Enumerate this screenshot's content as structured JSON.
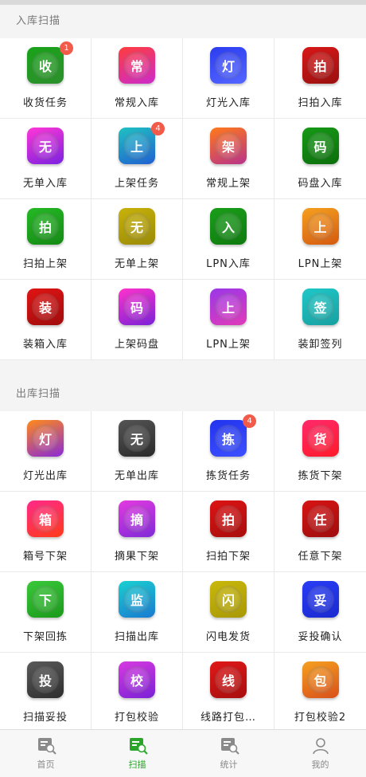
{
  "sections": [
    {
      "title": "入库扫描",
      "items": [
        {
          "glyph": "收",
          "label": "收货任务",
          "badge": "1",
          "colors": [
            "#19a319",
            "#2d8f2d"
          ]
        },
        {
          "glyph": "常",
          "label": "常规入库",
          "badge": "",
          "colors": [
            "#ff3d3d",
            "#cc2bcc"
          ]
        },
        {
          "glyph": "灯",
          "label": "灯光入库",
          "badge": "",
          "colors": [
            "#2b3cf0",
            "#5566ff"
          ]
        },
        {
          "glyph": "拍",
          "label": "扫拍入库",
          "badge": "",
          "colors": [
            "#d81818",
            "#9a1010"
          ]
        },
        {
          "glyph": "无",
          "label": "无单入库",
          "badge": "",
          "colors": [
            "#ff36d6",
            "#7b22e0"
          ]
        },
        {
          "glyph": "上",
          "label": "上架任务",
          "badge": "4",
          "colors": [
            "#1fc2c2",
            "#2060d0"
          ]
        },
        {
          "glyph": "架",
          "label": "常规上架",
          "badge": "",
          "colors": [
            "#ff7a1a",
            "#b8328a"
          ]
        },
        {
          "glyph": "码",
          "label": "码盘入库",
          "badge": "",
          "colors": [
            "#169a16",
            "#0c6e0c"
          ]
        },
        {
          "glyph": "拍",
          "label": "扫拍上架",
          "badge": "",
          "colors": [
            "#25b825",
            "#158a15"
          ]
        },
        {
          "glyph": "无",
          "label": "无单上架",
          "badge": "",
          "colors": [
            "#c8b20a",
            "#9a8a08"
          ]
        },
        {
          "glyph": "入",
          "label": "LPN入库",
          "badge": "",
          "colors": [
            "#1a9e1a",
            "#0f7a0f"
          ]
        },
        {
          "glyph": "上",
          "label": "LPN上架",
          "badge": "",
          "colors": [
            "#f5a020",
            "#d45a10"
          ]
        },
        {
          "glyph": "装",
          "label": "装箱入库",
          "badge": "",
          "colors": [
            "#e01414",
            "#a00c0c"
          ]
        },
        {
          "glyph": "码",
          "label": "上架码盘",
          "badge": "",
          "colors": [
            "#ff33cc",
            "#7a22d6"
          ]
        },
        {
          "glyph": "上",
          "label": "LPN上架",
          "badge": "",
          "colors": [
            "#9a38e8",
            "#e03ab8"
          ]
        },
        {
          "glyph": "签",
          "label": "装卸签列",
          "badge": "",
          "colors": [
            "#1fc7c7",
            "#18a0a0"
          ]
        }
      ]
    },
    {
      "title": "出库扫描",
      "items": [
        {
          "glyph": "灯",
          "label": "灯光出库",
          "badge": "",
          "colors": [
            "#ff8a1a",
            "#8a2ad6"
          ]
        },
        {
          "glyph": "无",
          "label": "无单出库",
          "badge": "",
          "colors": [
            "#555555",
            "#2a2a2a"
          ]
        },
        {
          "glyph": "拣",
          "label": "拣货任务",
          "badge": "4",
          "colors": [
            "#2233ee",
            "#3d50ff"
          ]
        },
        {
          "glyph": "货",
          "label": "拣货下架",
          "badge": "",
          "colors": [
            "#ff2a6a",
            "#ff1a2a"
          ]
        },
        {
          "glyph": "箱",
          "label": "箱号下架",
          "badge": "",
          "colors": [
            "#ff2a8a",
            "#ff3a1a"
          ]
        },
        {
          "glyph": "摘",
          "label": "摘果下架",
          "badge": "",
          "colors": [
            "#e43adf",
            "#7f2ad8"
          ]
        },
        {
          "glyph": "拍",
          "label": "扫拍下架",
          "badge": "",
          "colors": [
            "#dd1414",
            "#a80d0d"
          ]
        },
        {
          "glyph": "任",
          "label": "任意下架",
          "badge": "",
          "colors": [
            "#d81414",
            "#9e0d0d"
          ]
        },
        {
          "glyph": "下",
          "label": "下架回拣",
          "badge": "",
          "colors": [
            "#3ac83a",
            "#1a9a1a"
          ]
        },
        {
          "glyph": "监",
          "label": "扫描出库",
          "badge": "",
          "colors": [
            "#1ad0d0",
            "#1a7ad0"
          ]
        },
        {
          "glyph": "闪",
          "label": "闪电发货",
          "badge": "",
          "colors": [
            "#c9b80a",
            "#a89808"
          ]
        },
        {
          "glyph": "妥",
          "label": "妥投确认",
          "badge": "",
          "colors": [
            "#2a3cf5",
            "#1a2ad0"
          ]
        },
        {
          "glyph": "投",
          "label": "扫描妥投",
          "badge": "",
          "colors": [
            "#5a5a5a",
            "#2e2e2e"
          ]
        },
        {
          "glyph": "校",
          "label": "打包校验",
          "badge": "",
          "colors": [
            "#d83ae0",
            "#7a22d6"
          ]
        },
        {
          "glyph": "线",
          "label": "线路打包…",
          "badge": "",
          "colors": [
            "#e01818",
            "#a80e0e"
          ]
        },
        {
          "glyph": "包",
          "label": "打包校验2",
          "badge": "",
          "colors": [
            "#f5a020",
            "#d8501a"
          ]
        }
      ]
    }
  ],
  "tabs": [
    {
      "label": "首页",
      "icon": "home-doc-search-icon",
      "active": false
    },
    {
      "label": "扫描",
      "icon": "scan-doc-search-icon",
      "active": true
    },
    {
      "label": "统计",
      "icon": "stats-doc-search-icon",
      "active": false
    },
    {
      "label": "我的",
      "icon": "user-profile-icon",
      "active": false
    }
  ],
  "theme": {
    "active_color": "#2aa52a",
    "inactive_color": "#8a8a8a",
    "badge_color": "#f25a4a"
  }
}
